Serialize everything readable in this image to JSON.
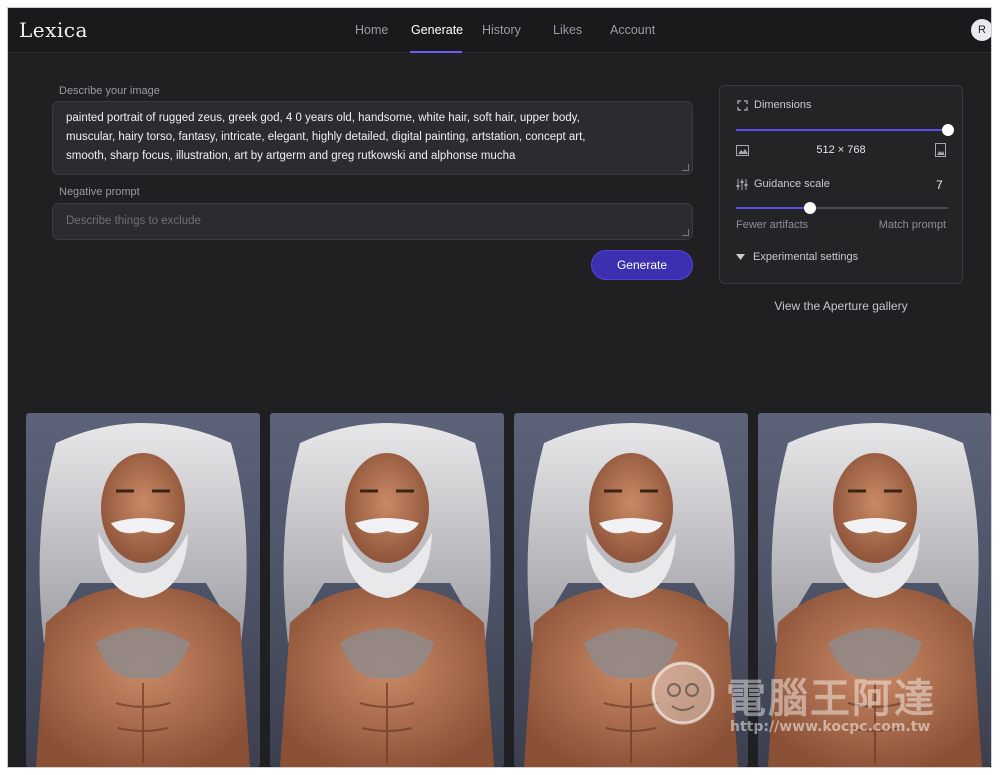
{
  "app": {
    "logo": "Lexica",
    "avatar_initial": "R"
  },
  "nav": {
    "items": [
      "Home",
      "Generate",
      "History",
      "Likes",
      "Account"
    ],
    "active": "Generate"
  },
  "form": {
    "prompt_label": "Describe your image",
    "prompt_lines": [
      "painted portrait of rugged zeus, greek god, 4 0 years old, handsome, white hair, soft hair, upper body,",
      "muscular, hairy torso, fantasy, intricate, elegant, highly detailed, digital painting, artstation, concept art,",
      "smooth, sharp focus, illustration, art by artgerm and greg rutkowski and alphonse mucha"
    ],
    "negative_label": "Negative prompt",
    "negative_placeholder": "Describe things to exclude",
    "generate_label": "Generate"
  },
  "settings": {
    "dimensions_label": "Dimensions",
    "dimensions_value": "512 × 768",
    "guidance_label": "Guidance scale",
    "guidance_value": "7",
    "dimension_slider_fraction": 1.0,
    "guidance_slider_fraction": 0.35,
    "fewer_label": "Fewer artifacts",
    "match_label": "Match prompt",
    "experimental_label": "Experimental settings",
    "accent_color": "#5b4ee8"
  },
  "gallery_link": "View the Aperture gallery",
  "images": [
    {
      "name": "generated-image-1"
    },
    {
      "name": "generated-image-2"
    },
    {
      "name": "generated-image-3"
    },
    {
      "name": "generated-image-4"
    }
  ],
  "watermark": {
    "brand_text": "電腦王阿達",
    "url_text": "http://www.kocpc.com.tw"
  }
}
